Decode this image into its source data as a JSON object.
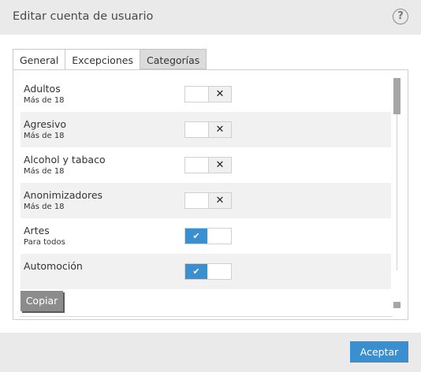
{
  "window": {
    "title": "Editar cuenta de usuario",
    "help_symbol": "?"
  },
  "tabs": [
    {
      "label": "General",
      "active": false
    },
    {
      "label": "Excepciones",
      "active": false
    },
    {
      "label": "Categorías",
      "active": true
    }
  ],
  "categories": [
    {
      "name": "Adultos",
      "rating": "Más de 18",
      "enabled": false,
      "toggle_symbol": "✕"
    },
    {
      "name": "Agresivo",
      "rating": "Más de 18",
      "enabled": false,
      "toggle_symbol": "✕"
    },
    {
      "name": "Alcohol y tabaco",
      "rating": "Más de 18",
      "enabled": false,
      "toggle_symbol": "✕"
    },
    {
      "name": "Anonimizadores",
      "rating": "Más de 18",
      "enabled": false,
      "toggle_symbol": "✕"
    },
    {
      "name": "Artes",
      "rating": "Para todos",
      "enabled": true,
      "toggle_symbol": "✔"
    },
    {
      "name": "Automoción",
      "rating": "",
      "enabled": true,
      "toggle_symbol": "✔"
    }
  ],
  "buttons": {
    "copy": "Copiar",
    "accept": "Aceptar"
  },
  "colors": {
    "accent": "#3a8fd0",
    "copy_button": "#8c8c8c",
    "alt_row": "#f1f1f1"
  }
}
